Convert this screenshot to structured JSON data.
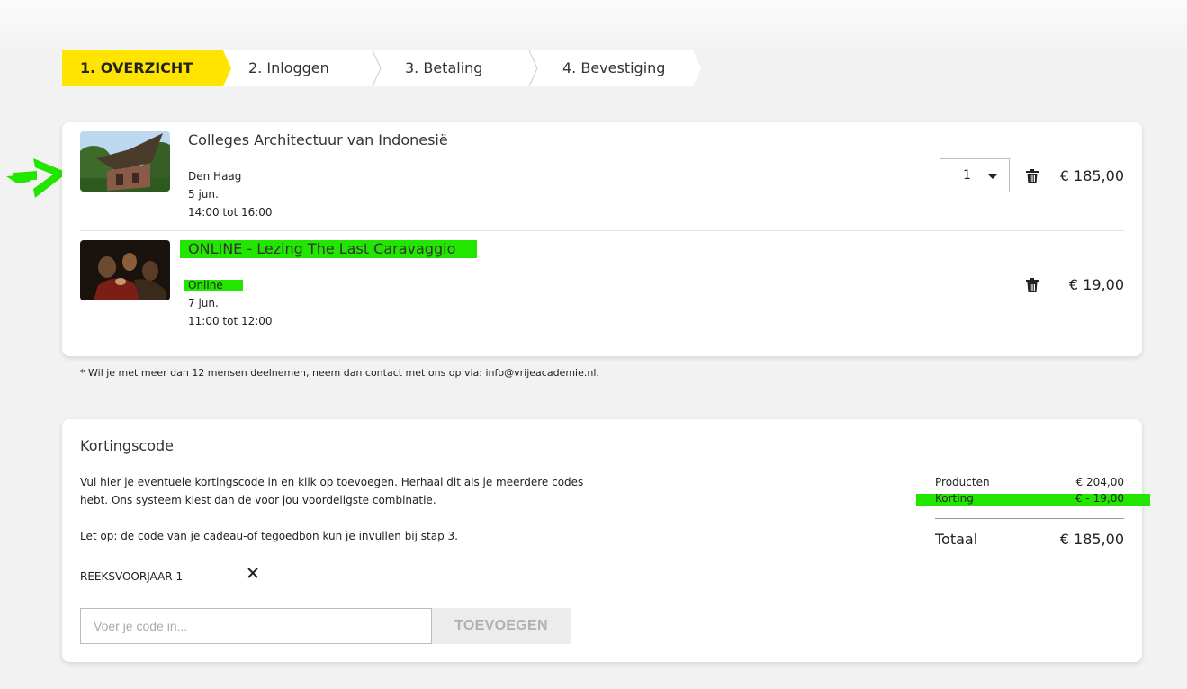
{
  "steps": [
    {
      "label": "1. OVERZICHT"
    },
    {
      "label": "2. Inloggen"
    },
    {
      "label": "3. Betaling"
    },
    {
      "label": "4. Bevestiging"
    }
  ],
  "items": [
    {
      "title": "Colleges Architectuur van Indonesië",
      "location": "Den Haag",
      "date": "5 jun.",
      "time": "14:00 tot 16:00",
      "quantity": "1",
      "price": "€ 185,00"
    },
    {
      "title": "ONLINE - Lezing The Last Caravaggio",
      "location": "Online",
      "date": "7 jun.",
      "time": "11:00 tot 12:00",
      "price": "€ 19,00"
    }
  ],
  "note": "* Wil je met meer dan 12 mensen deelnemen, neem dan contact met ons op via: info@vrijeacademie.nl.",
  "discount": {
    "title": "Kortingscode",
    "text1": "Vul hier je eventuele kortingscode in en klik op toevoegen. Herhaal dit als je meerdere codes hebt. Ons systeem kiest dan de voor jou voordeligste combinatie.",
    "text2": "Let op: de code van je cadeau-of tegoedbon kun je invullen bij stap 3.",
    "applied_code": "REEKSVOORJAAR-1",
    "input_placeholder": "Voer je code in...",
    "add_button": "TOEVOEGEN"
  },
  "summary": {
    "products_label": "Producten",
    "products_value": "€ 204,00",
    "discount_label": "Korting",
    "discount_value": "€ - 19,00",
    "total_label": "Totaal",
    "total_value": "€ 185,00"
  },
  "colors": {
    "accent": "#ffe400",
    "highlight": "#22e600"
  }
}
